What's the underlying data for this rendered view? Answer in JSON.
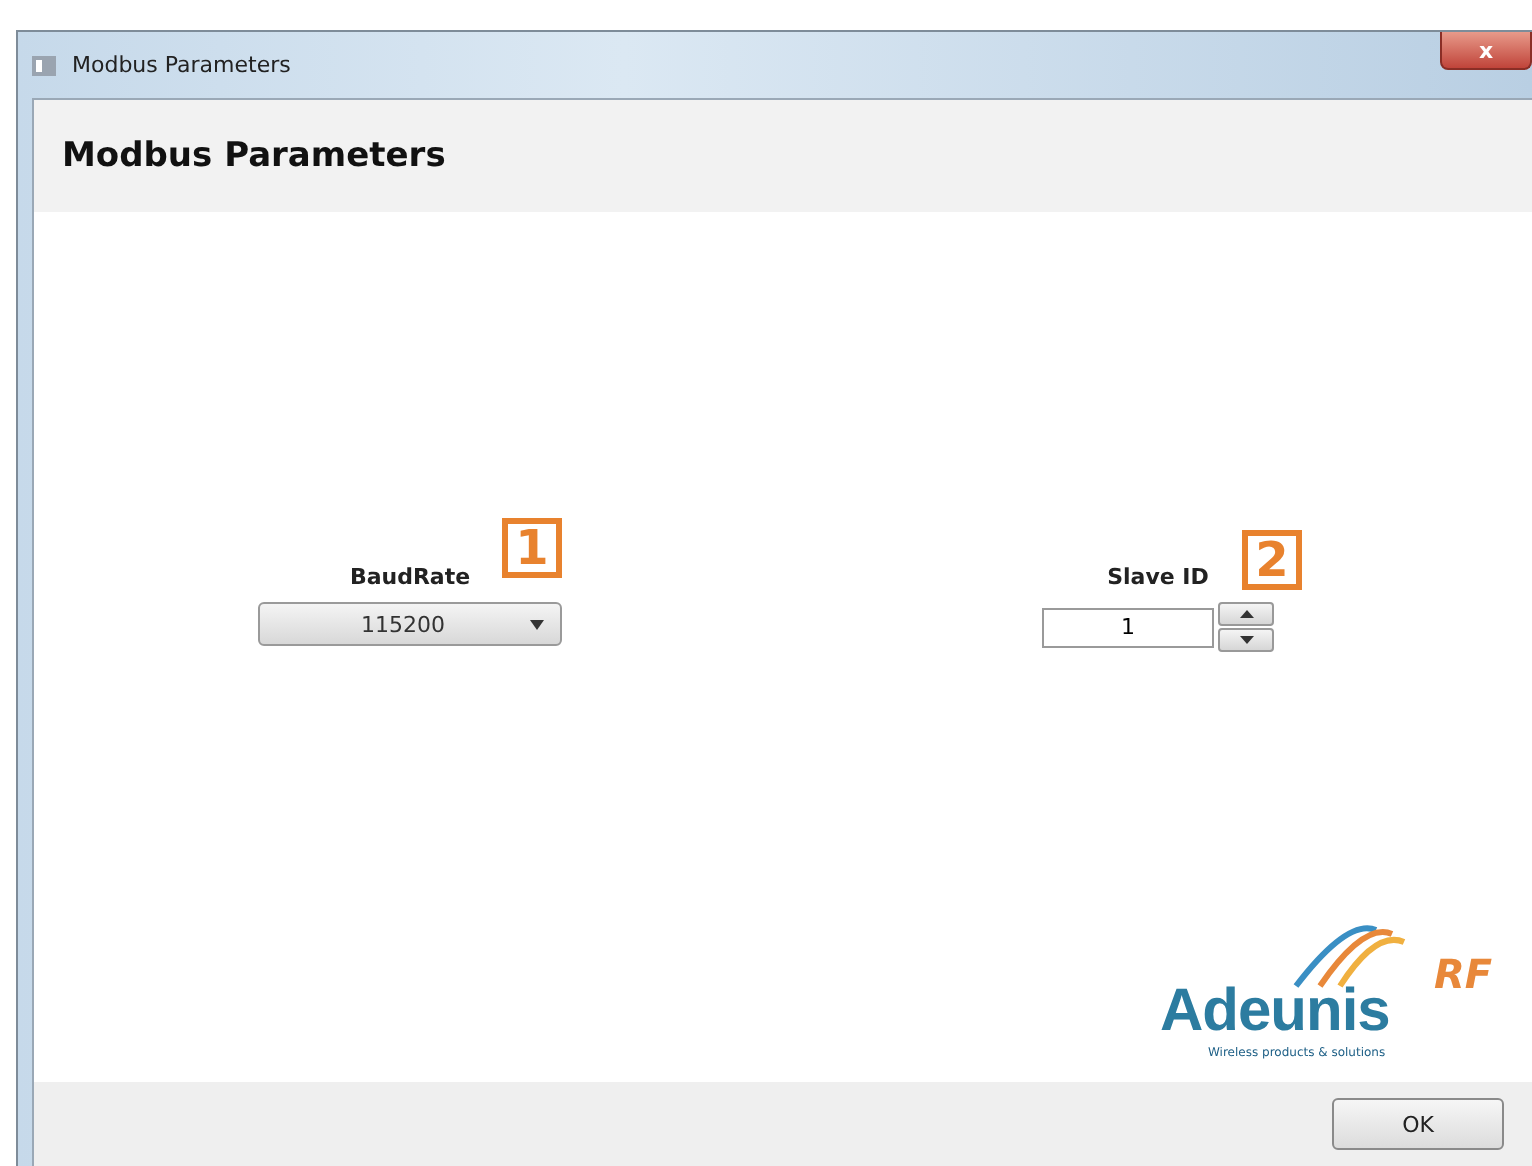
{
  "window": {
    "title": "Modbus Parameters",
    "close": "x"
  },
  "header": {
    "title": "Modbus Parameters"
  },
  "baud_rate": {
    "label": "BaudRate",
    "value": "115200",
    "marker": "1"
  },
  "slave_id": {
    "label": "Slave ID",
    "value": "1",
    "marker": "2"
  },
  "logo": {
    "main": "Adeunis",
    "suffix": "RF",
    "tagline": "Wireless products & solutions"
  },
  "buttons": [
    "OK"
  ]
}
